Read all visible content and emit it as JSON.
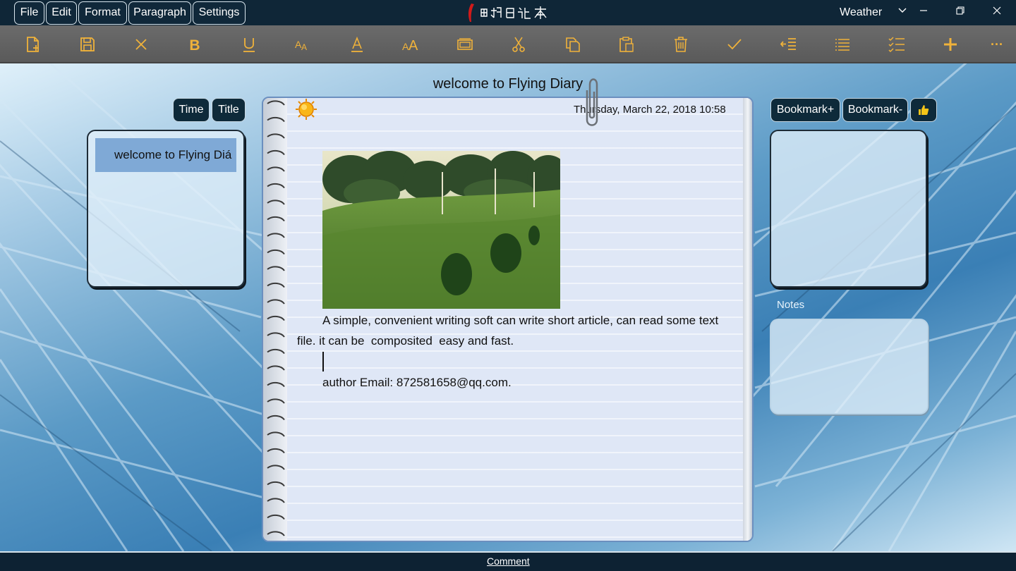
{
  "menu": {
    "file": "File",
    "edit": "Edit",
    "format": "Format",
    "paragraph": "Paragraph",
    "settings": "Settings"
  },
  "titlebar": {
    "weather": "Weather",
    "chevron": "chevron-down-icon",
    "minimize": "minimize-icon",
    "restore": "restore-icon",
    "close": "close-icon"
  },
  "toolbar": {
    "icons": [
      "new-file-icon",
      "save-icon",
      "close-doc-icon",
      "bold-icon",
      "underline-icon",
      "font-size-icon",
      "font-color-icon",
      "font-case-icon",
      "insert-picture-icon",
      "cut-icon",
      "copy-icon",
      "paste-icon",
      "delete-icon",
      "check-icon",
      "indent-icon",
      "list-icon",
      "checklist-icon",
      "add-icon",
      "more-icon"
    ],
    "more_label": "···"
  },
  "page": {
    "title": "welcome to Flying Diary"
  },
  "left": {
    "time_button": "Time",
    "title_button": "Title",
    "entries": [
      "welcome to Flying Diá"
    ]
  },
  "editor": {
    "date": "Thursday, March 22, 2018 10:58",
    "weather_icon": "sun-icon",
    "line1": "A simple, convenient writing soft can write short article, can read some text",
    "line2": "file. it can be  composited  easy and fast.",
    "line3": "author Email: 872581658@qq.com."
  },
  "right": {
    "bookmark_add": "Bookmark+",
    "bookmark_remove": "Bookmark-",
    "like_icon": "thumbs-up-icon",
    "notes_label": "Notes"
  },
  "status": {
    "comment": "Comment"
  },
  "colors": {
    "titlebar": "#0f2637",
    "toolbar": "#636363",
    "toolbar_icon": "#f0b23a",
    "selection": "#7fa9d6"
  }
}
